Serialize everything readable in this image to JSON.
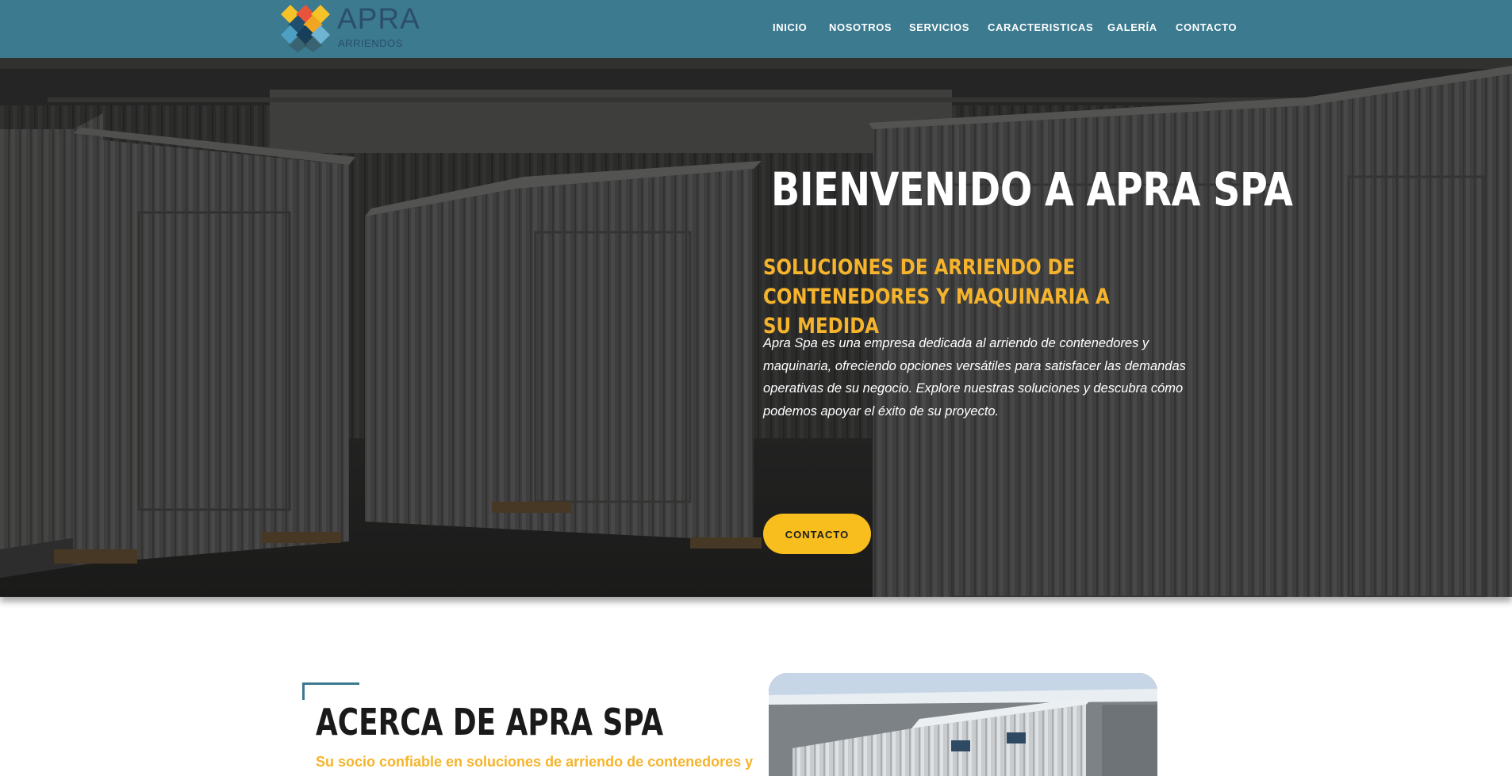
{
  "header": {
    "logo": {
      "title": "APRA",
      "subtitle": "ARRIENDOS"
    },
    "nav": [
      "INICIO",
      "NOSOTROS",
      "SERVICIOS",
      "CARACTERISTICAS",
      "GALERÍA",
      "CONTACTO"
    ]
  },
  "hero": {
    "title": "BIENVENIDO A APRA SPA",
    "subtitle": "SOLUCIONES DE ARRIENDO DE CONTENEDORES Y MAQUINARIA A SU MEDIDA",
    "text": "Apra Spa es una empresa dedicada al arriendo de contenedores y maquinaria, ofreciendo opciones versátiles para satisfacer las demandas operativas de su negocio. Explore nuestras soluciones y descubra cómo podemos apoyar el éxito de su proyecto.",
    "button": "CONTACTO"
  },
  "about": {
    "title": "ACERCA DE APRA SPA",
    "subtitle": "Su socio confiable en soluciones de arriendo de contenedores y"
  },
  "colors": {
    "header_bg": "#3b7a8f",
    "accent_yellow": "#f7be1e",
    "accent_orange": "#f6b42c",
    "logo_text": "#2b4e6b"
  },
  "icons": {
    "logo": "apra-diamond-logo-icon"
  }
}
